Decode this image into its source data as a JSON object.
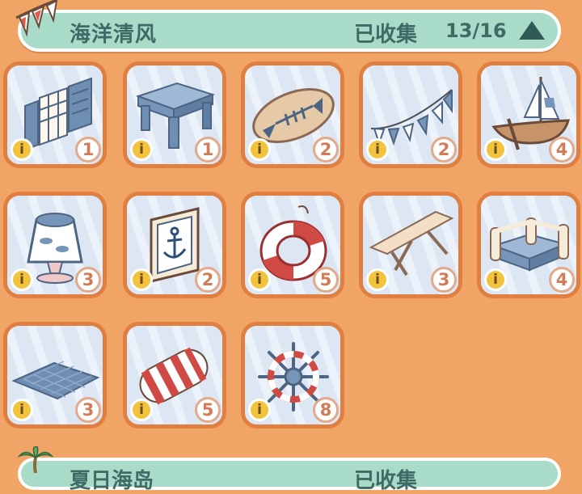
{
  "header": {
    "title": "海洋清风",
    "collected_label": "已收集",
    "count": "13/16",
    "toggle_icon": "triangle-up-icon",
    "flag_icon": "bunting-flag-icon"
  },
  "colors": {
    "background": "#f0a466",
    "header_bg": "#a8dcc8",
    "header_text": "#406a66",
    "card_border": "#e07f40",
    "card_bg": "#dde7f3",
    "info_badge": "#f2c33d",
    "qty_text": "#d27c57"
  },
  "items": [
    {
      "icon": "shutter-window-icon",
      "qty": "1",
      "info": "i"
    },
    {
      "icon": "stool-icon",
      "qty": "1",
      "info": "i"
    },
    {
      "icon": "fish-sign-icon",
      "qty": "2",
      "info": "i"
    },
    {
      "icon": "pennant-garland-icon",
      "qty": "2",
      "info": "i"
    },
    {
      "icon": "sailboat-icon",
      "qty": "4",
      "info": "i"
    },
    {
      "icon": "fish-lamp-icon",
      "qty": "3",
      "info": "i"
    },
    {
      "icon": "anchor-frame-icon",
      "qty": "2",
      "info": "i"
    },
    {
      "icon": "life-ring-icon",
      "qty": "5",
      "info": "i"
    },
    {
      "icon": "folding-table-icon",
      "qty": "3",
      "info": "i"
    },
    {
      "icon": "log-sofa-icon",
      "qty": "4",
      "info": "i"
    },
    {
      "icon": "rug-icon",
      "qty": "3",
      "info": "i"
    },
    {
      "icon": "striped-cushion-icon",
      "qty": "5",
      "info": "i"
    },
    {
      "icon": "ship-wheel-icon",
      "qty": "8",
      "info": "i"
    }
  ],
  "next_section": {
    "title": "夏日海岛",
    "collected_label": "已收集",
    "icon": "palm-tree-icon"
  }
}
